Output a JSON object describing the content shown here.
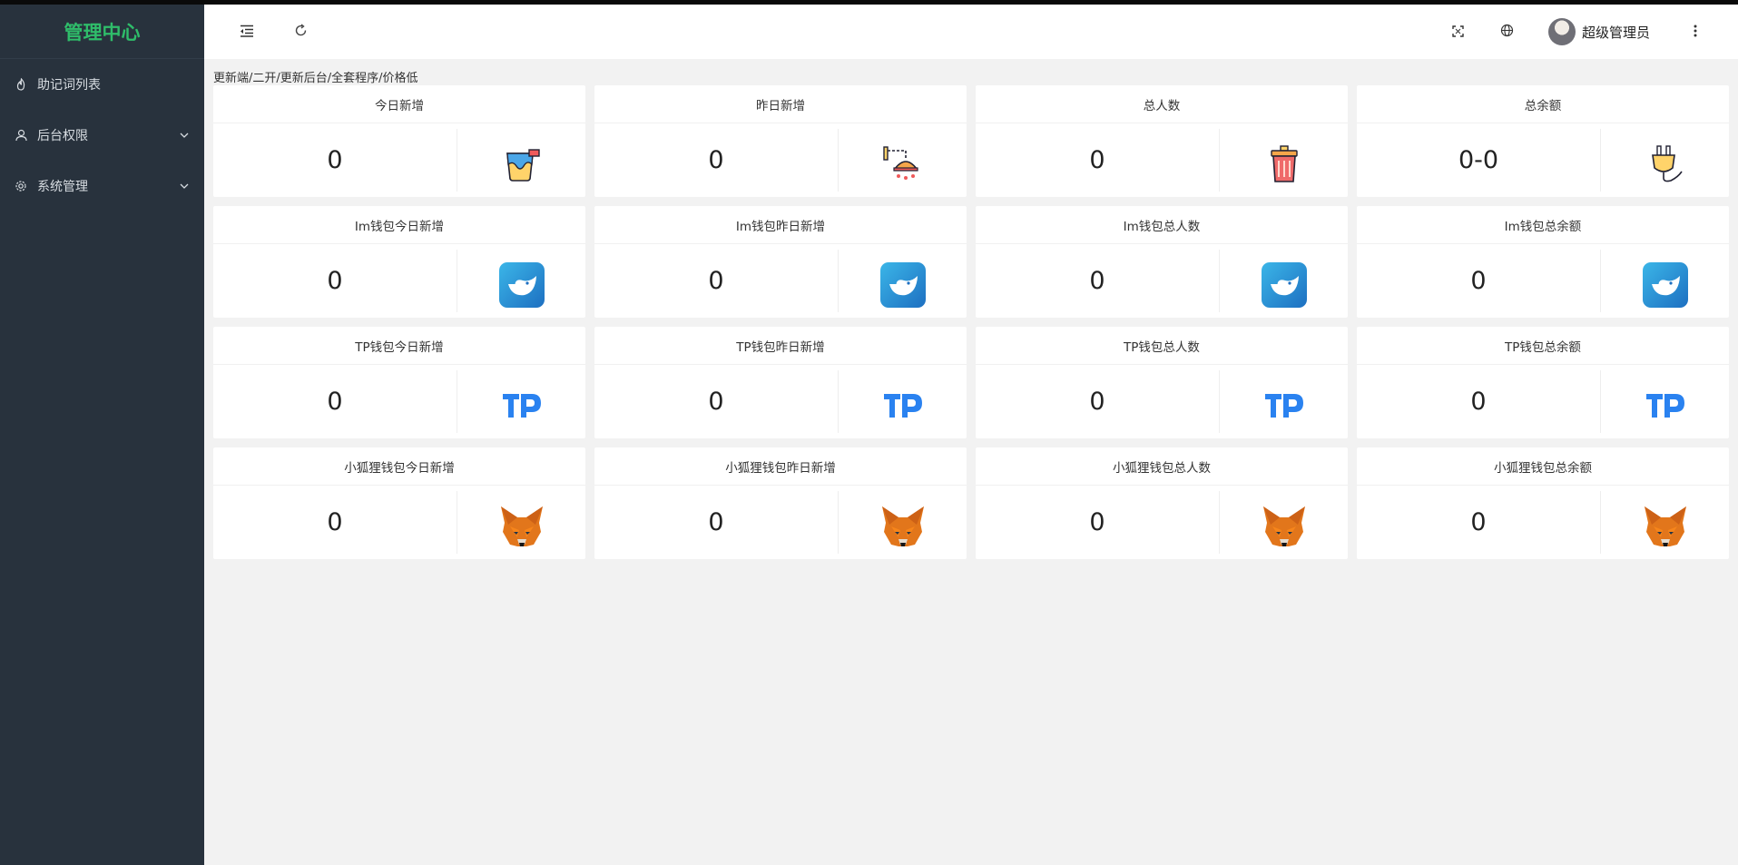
{
  "app": {
    "title": "管理中心"
  },
  "sidebar": {
    "items": [
      {
        "label": "助记词列表",
        "icon": "fire-icon",
        "has_children": false
      },
      {
        "label": "后台权限",
        "icon": "user-icon",
        "has_children": true
      },
      {
        "label": "系统管理",
        "icon": "gear-icon",
        "has_children": true
      }
    ]
  },
  "header": {
    "menu_icon": "menu-fold-icon",
    "refresh_icon": "refresh-icon",
    "fullscreen_icon": "fullscreen-icon",
    "language_icon": "globe-icon",
    "user_name": "超级管理员",
    "more_icon": "more-vertical-icon"
  },
  "notice": "更新端/二开/更新后台/全套程序/价格低",
  "cards": [
    {
      "title": "今日新增",
      "value": "0",
      "icon": "paint-bucket-icon"
    },
    {
      "title": "昨日新增",
      "value": "0",
      "icon": "shower-icon"
    },
    {
      "title": "总人数",
      "value": "0",
      "icon": "trash-bin-icon"
    },
    {
      "title": "总余额",
      "value": "0-0",
      "icon": "plug-icon"
    },
    {
      "title": "Im钱包今日新增",
      "value": "0",
      "icon": "imtoken-logo-icon"
    },
    {
      "title": "Im钱包昨日新增",
      "value": "0",
      "icon": "imtoken-logo-icon"
    },
    {
      "title": "Im钱包总人数",
      "value": "0",
      "icon": "imtoken-logo-icon"
    },
    {
      "title": "Im钱包总余额",
      "value": "0",
      "icon": "imtoken-logo-icon"
    },
    {
      "title": "TP钱包今日新增",
      "value": "0",
      "icon": "tokenpocket-logo-icon"
    },
    {
      "title": "TP钱包昨日新增",
      "value": "0",
      "icon": "tokenpocket-logo-icon"
    },
    {
      "title": "TP钱包总人数",
      "value": "0",
      "icon": "tokenpocket-logo-icon"
    },
    {
      "title": "TP钱包总余额",
      "value": "0",
      "icon": "tokenpocket-logo-icon"
    },
    {
      "title": "小狐狸钱包今日新增",
      "value": "0",
      "icon": "metamask-fox-icon"
    },
    {
      "title": "小狐狸钱包昨日新增",
      "value": "0",
      "icon": "metamask-fox-icon"
    },
    {
      "title": "小狐狸钱包总人数",
      "value": "0",
      "icon": "metamask-fox-icon"
    },
    {
      "title": "小狐狸钱包总余额",
      "value": "0",
      "icon": "metamask-fox-icon"
    }
  ],
  "colors": {
    "sidebar_bg": "#28323d",
    "logo_green": "#2fbd6a",
    "content_bg": "#f2f2f2"
  }
}
